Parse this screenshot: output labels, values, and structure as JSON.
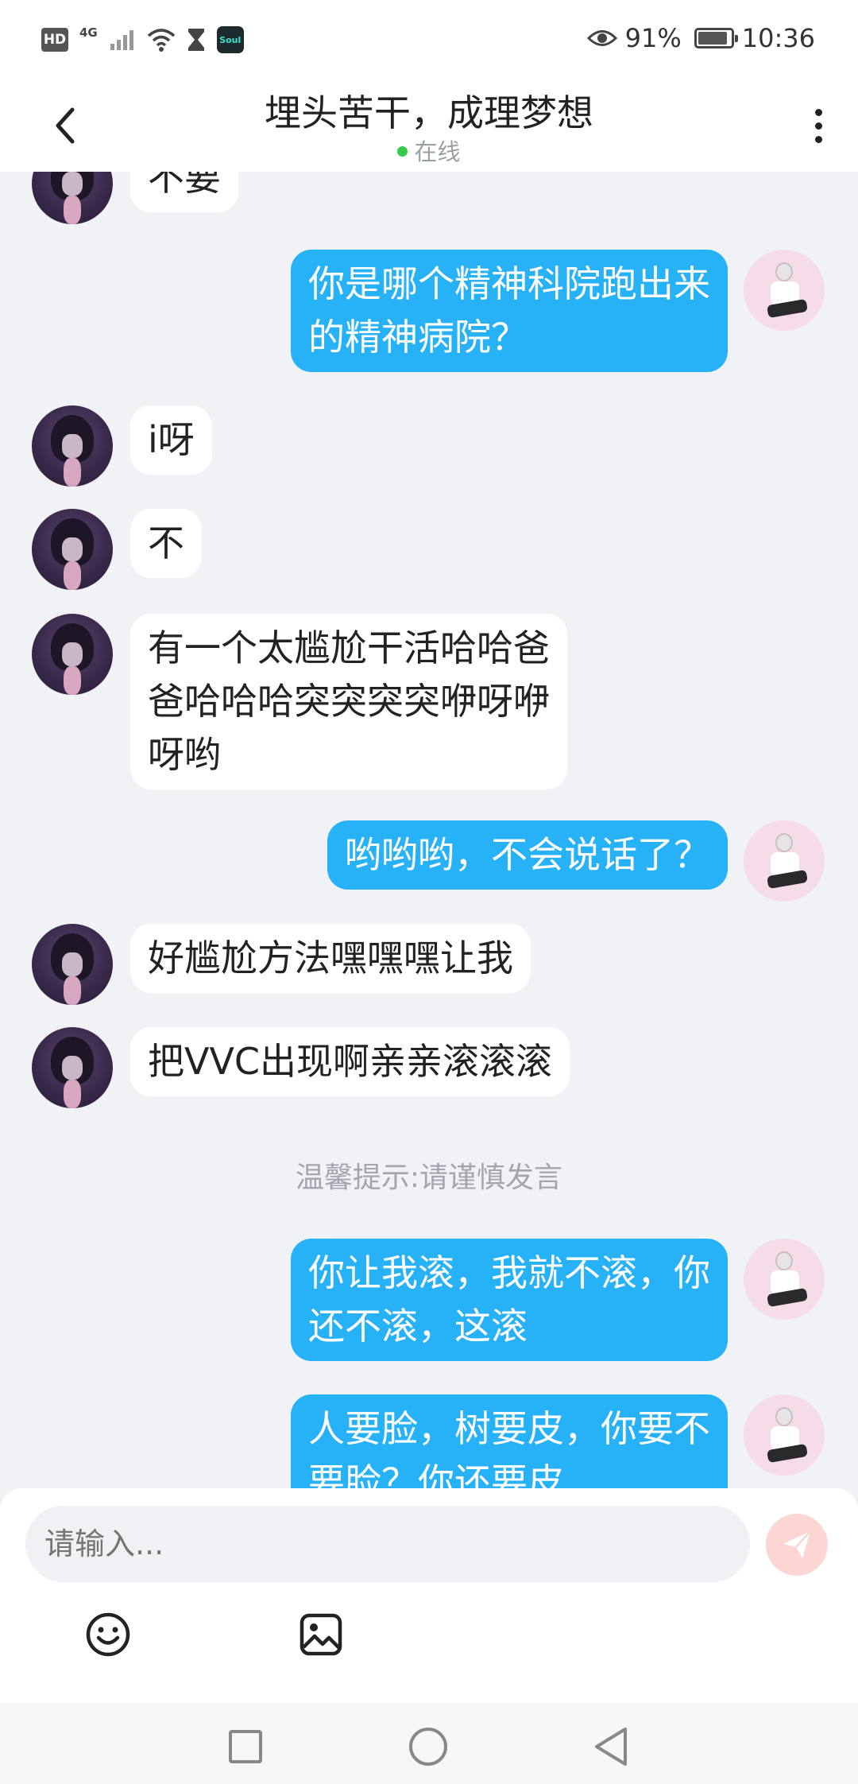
{
  "status_bar": {
    "hd": "HD",
    "network": "4G",
    "app_icon": "Soul",
    "battery_text": "91%",
    "battery_level": 0.91,
    "time": "10:36",
    "icons": [
      "signal-icon",
      "wifi-icon",
      "hourglass-icon",
      "eye-icon",
      "battery-icon"
    ]
  },
  "header": {
    "title": "埋头苦干，成理梦想",
    "status": "在线",
    "status_color": "#35c94e"
  },
  "messages": [
    {
      "side": "left",
      "text": "不要"
    },
    {
      "side": "right",
      "text": "你是哪个精神科院跑出来\n的精神病院？"
    },
    {
      "side": "left",
      "text": "i呀"
    },
    {
      "side": "left",
      "text": "不"
    },
    {
      "side": "left",
      "text": "有一个太尴尬干活哈哈爸\n爸哈哈哈突突突突咿呀咿\n呀哟"
    },
    {
      "side": "right",
      "text": "哟哟哟，不会说话了？"
    },
    {
      "side": "left",
      "text": "好尴尬方法嘿嘿嘿让我"
    },
    {
      "side": "left",
      "text": "把VVC出现啊亲亲滚滚滚"
    },
    {
      "side": "right",
      "text": "你让我滚，我就不滚，你\n还不滚，这滚"
    },
    {
      "side": "right",
      "text": "人要脸，树要皮，你要不\n要脸？你还要皮"
    }
  ],
  "tip": "温馨提示:请谨慎发言",
  "input": {
    "placeholder": "请输入..."
  },
  "colors": {
    "outgoing_bubble": "#27b1f7",
    "incoming_bubble": "#ffffff",
    "send_button": "#fbd6d3"
  },
  "toolbar": [
    "emoji-icon",
    "image-icon"
  ],
  "nav": [
    "recent-apps-icon",
    "home-icon",
    "back-icon"
  ]
}
